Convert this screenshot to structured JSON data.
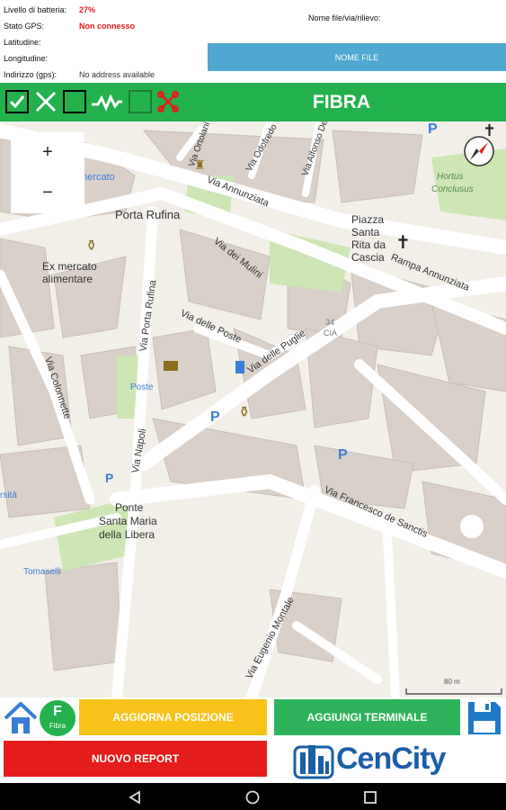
{
  "info": {
    "battery_label": "Livello di batteria:",
    "battery_value": "27%",
    "gps_label": "Stato GPS:",
    "gps_value": "Non connesso",
    "lat_label": "Latitudine:",
    "lng_label": "Longitudine:",
    "address_label": "Indirizzo (gps):",
    "address_value": "No address available",
    "filename_label": "Nome file/via/rilievo:",
    "filename_button": "NOME FILE"
  },
  "toolbar": {
    "title": "FIBRA",
    "tools": [
      "checkbox-checked-icon",
      "cross-icon",
      "square-icon",
      "zigzag-line-icon",
      "square-icon",
      "cut-cross-icon"
    ]
  },
  "map": {
    "zoom_in": "+",
    "zoom_out": "−",
    "scale": "80 m",
    "labels": [
      {
        "text": "Porta Rufina"
      },
      {
        "text": "Ex mercato"
      },
      {
        "text": "alimentare"
      },
      {
        "text": "mercato"
      },
      {
        "text": "Via Annunziata"
      },
      {
        "text": "Piazza"
      },
      {
        "text": "Santa"
      },
      {
        "text": "Rita da"
      },
      {
        "text": "Cascia"
      },
      {
        "text": "Rampa Annunziata"
      },
      {
        "text": "Hortus"
      },
      {
        "text": "Conclusus"
      },
      {
        "text": "Via dei Mulini"
      },
      {
        "text": "Via delle Poste"
      },
      {
        "text": "Via delle Puglie"
      },
      {
        "text": "34"
      },
      {
        "text": "CIA"
      },
      {
        "text": "Via Porta Rufina"
      },
      {
        "text": "Poste"
      },
      {
        "text": "Via Colonnette"
      },
      {
        "text": "Via Napoli"
      },
      {
        "text": "Ponte"
      },
      {
        "text": "Santa Maria"
      },
      {
        "text": "della Libera"
      },
      {
        "text": "Tomaselli"
      },
      {
        "text": "Via Francesco de Sanctis"
      },
      {
        "text": "Via Eugenio Montale"
      },
      {
        "text": "Via Ortolani"
      },
      {
        "text": "Via Odofredo"
      },
      {
        "text": "Via Alfonso De"
      },
      {
        "text": "rsità"
      }
    ]
  },
  "buttons": {
    "home_icon": "home-icon",
    "badge_letter": "F",
    "badge_sub": "Fibra",
    "update_position": "AGGIORNA POSIZIONE",
    "add_terminal": "AGGIUNGI TERMINALE",
    "save_icon": "floppy-disk-icon",
    "new_report": "NUOVO REPORT",
    "logo_text": "CenCity"
  },
  "colors": {
    "toolbar_green": "#23b14d",
    "button_yellow": "#f7c31b",
    "button_green": "#2fb35a",
    "button_red": "#e51c1c",
    "nome_file_blue": "#4fa8cf",
    "brand_blue": "#1b5fa6"
  },
  "navbar": {
    "icons": [
      "back-icon",
      "home-circle-icon",
      "recent-apps-icon"
    ]
  }
}
